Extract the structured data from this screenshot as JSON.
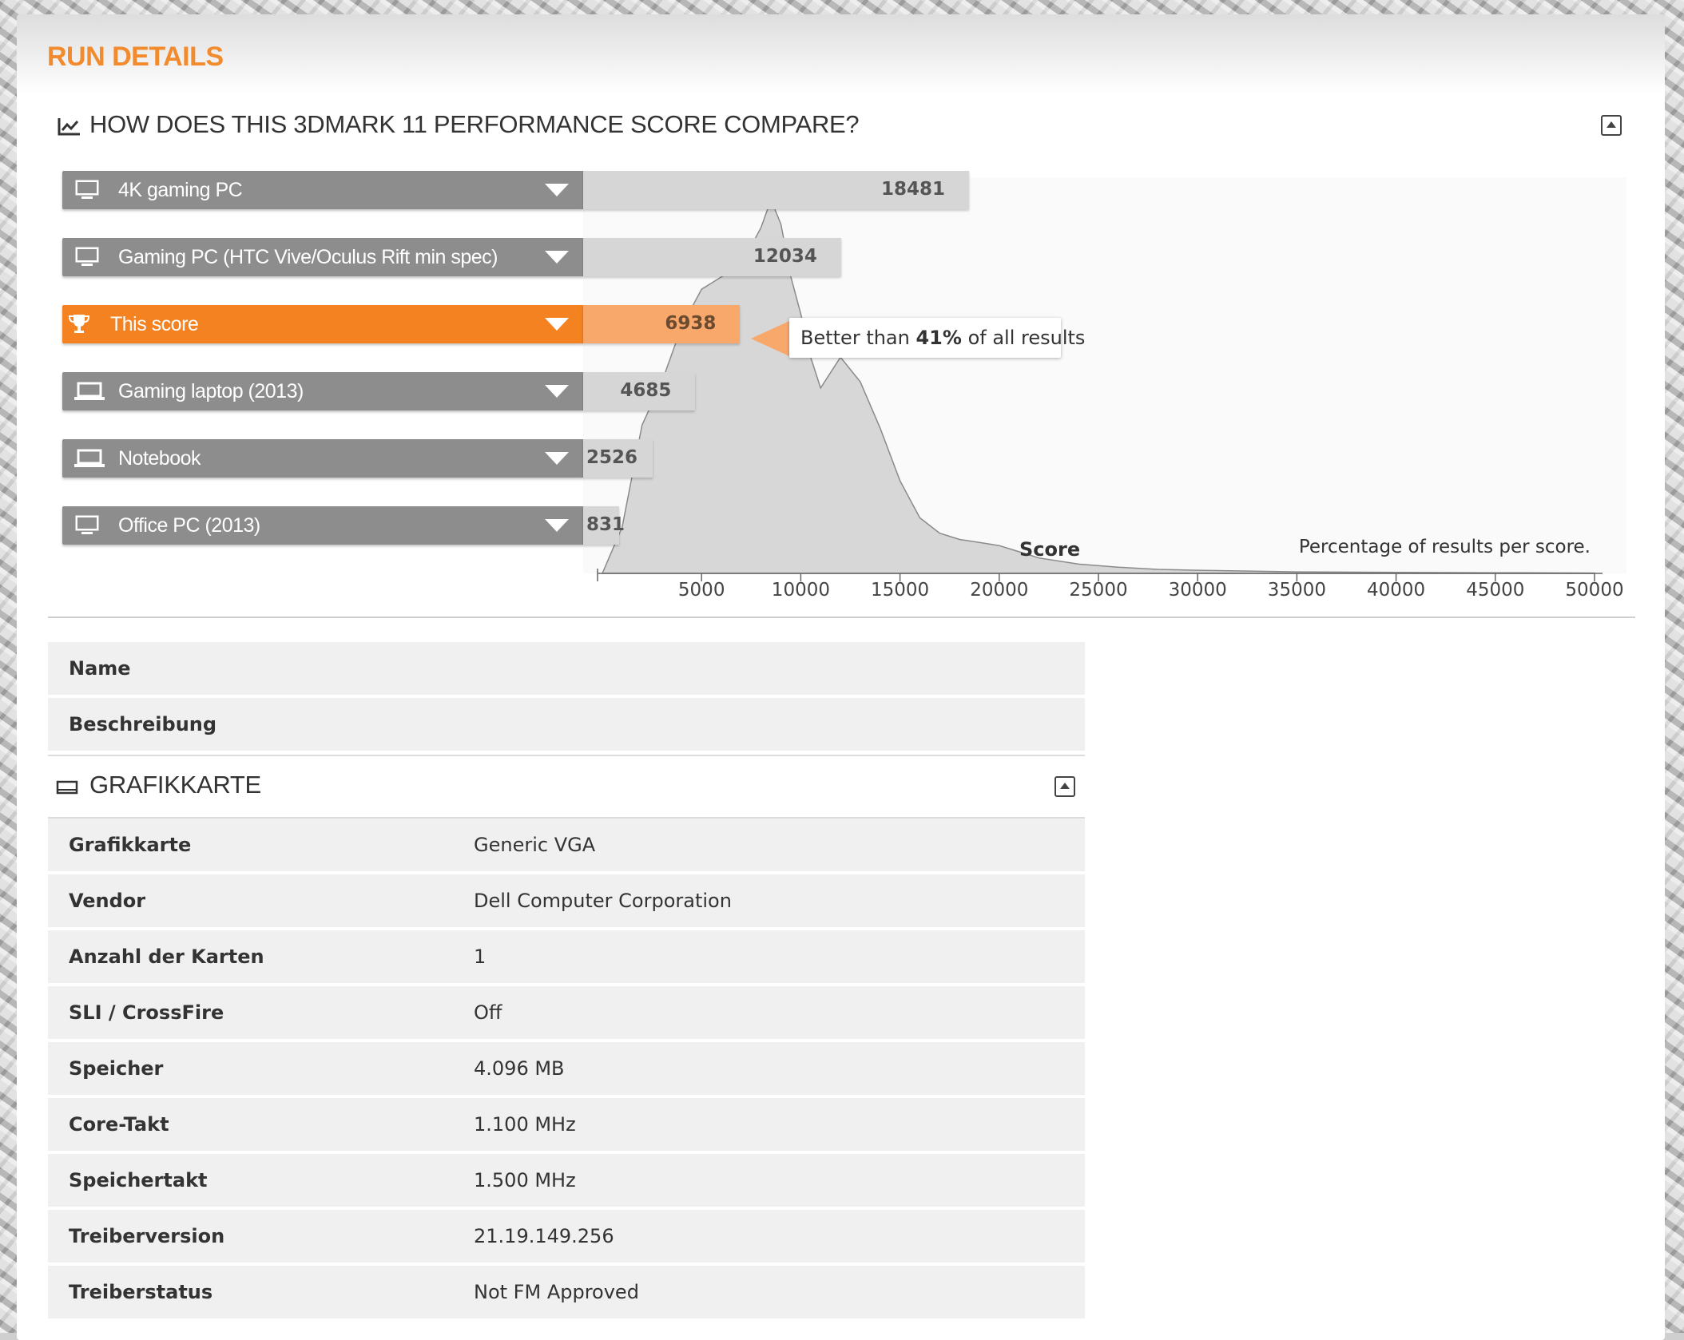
{
  "page": {
    "run_title": "RUN DETAILS"
  },
  "compare": {
    "title": "HOW DOES THIS 3DMARK 11 PERFORMANCE SCORE COMPARE?",
    "rows": [
      {
        "label": "4K gaming PC",
        "score": 18481,
        "score_text": "18481",
        "icon": "monitor-icon",
        "active": false
      },
      {
        "label": "Gaming PC (HTC Vive/Oculus Rift min spec)",
        "score": 12034,
        "score_text": "12034",
        "icon": "monitor-icon",
        "active": false
      },
      {
        "label": "This score",
        "score": 6938,
        "score_text": "6938",
        "icon": "trophy-icon",
        "active": true
      },
      {
        "label": "Gaming laptop (2013)",
        "score": 4685,
        "score_text": "4685",
        "icon": "laptop-icon",
        "active": false
      },
      {
        "label": "Notebook",
        "score": 2526,
        "score_text": "2526",
        "icon": "laptop-icon",
        "active": false
      },
      {
        "label": "Office PC (2013)",
        "score": 831,
        "score_text": "831",
        "icon": "monitor-icon",
        "active": false
      }
    ],
    "tooltip": {
      "prefix": "Better than ",
      "percent": "41%",
      "suffix": " of all results"
    },
    "x_axis_label": "Score",
    "y_caption": "Percentage of results per score.",
    "accent_color": "#f58220"
  },
  "chart_data": {
    "type": "area",
    "title": "",
    "xlabel": "Score",
    "ylabel": "Percentage of results per score.",
    "xlim": [
      0,
      50000
    ],
    "x_ticks": [
      5000,
      10000,
      15000,
      20000,
      25000,
      30000,
      35000,
      40000,
      45000,
      50000
    ],
    "x": [
      0,
      1000,
      2000,
      3000,
      4000,
      5000,
      6000,
      7000,
      8000,
      8500,
      9000,
      9500,
      10000,
      10500,
      11000,
      12000,
      13000,
      14000,
      15000,
      16000,
      17000,
      18000,
      19000,
      20000,
      21000,
      22000,
      24000,
      26000,
      28000,
      30000,
      35000,
      40000,
      45000,
      50000
    ],
    "y": [
      0,
      15,
      48,
      62,
      80,
      92,
      96,
      100,
      112,
      121,
      113,
      96,
      84,
      70,
      60,
      70,
      62,
      47,
      30,
      18,
      13,
      11,
      10,
      9,
      7,
      5,
      3,
      2,
      1.3,
      1,
      0.5,
      0.3,
      0.2,
      0.1
    ],
    "grid": false,
    "markers": [
      {
        "name": "4K gaming PC",
        "value": 18481
      },
      {
        "name": "Gaming PC (HTC Vive/Oculus Rift min spec)",
        "value": 12034
      },
      {
        "name": "This score",
        "value": 6938
      },
      {
        "name": "Gaming laptop (2013)",
        "value": 4685
      },
      {
        "name": "Notebook",
        "value": 2526
      },
      {
        "name": "Office PC (2013)",
        "value": 831
      }
    ]
  },
  "info": {
    "rows": [
      {
        "key": "Name",
        "value": ""
      },
      {
        "key": "Beschreibung",
        "value": ""
      }
    ]
  },
  "gpu": {
    "title": "GRAFIKKARTE",
    "rows": [
      {
        "key": "Grafikkarte",
        "value": "Generic VGA"
      },
      {
        "key": "Vendor",
        "value": "Dell Computer Corporation"
      },
      {
        "key": "Anzahl der Karten",
        "value": "1"
      },
      {
        "key": "SLI / CrossFire",
        "value": "Off"
      },
      {
        "key": "Speicher",
        "value": "4.096 MB"
      },
      {
        "key": "Core-Takt",
        "value": "1.100 MHz"
      },
      {
        "key": "Speichertakt",
        "value": "1.500 MHz"
      },
      {
        "key": "Treiberversion",
        "value": "21.19.149.256"
      },
      {
        "key": "Treiberstatus",
        "value": "Not FM Approved"
      }
    ]
  }
}
